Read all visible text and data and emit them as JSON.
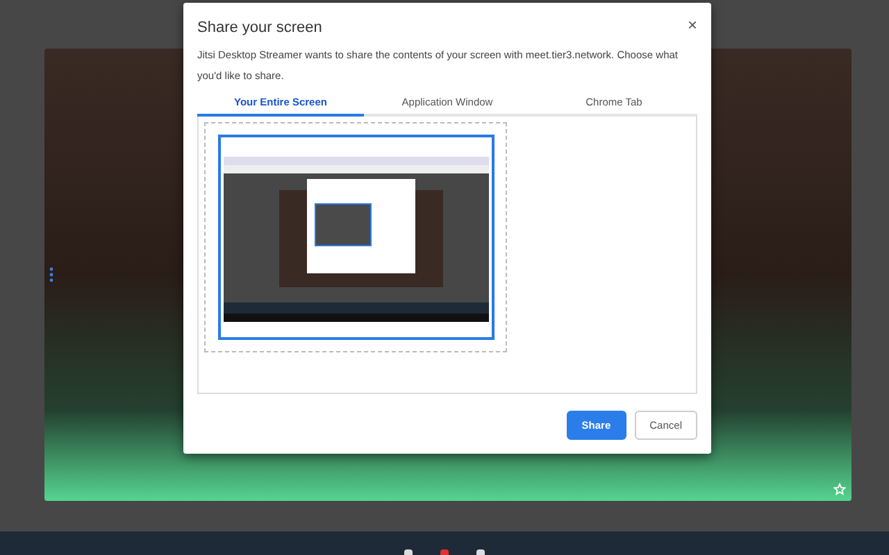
{
  "dialog": {
    "title": "Share your screen",
    "close": "×",
    "message": "Jitsi Desktop Streamer wants to share the contents of your screen with meet.tier3.network. Choose what you'd like to share.",
    "tabs": [
      {
        "label": "Your Entire Screen",
        "selected": true
      },
      {
        "label": "Application Window",
        "selected": false
      },
      {
        "label": "Chrome Tab",
        "selected": false
      }
    ],
    "sources": [
      {
        "selected": true
      }
    ],
    "buttons": [
      {
        "label": "Share",
        "kind": "primary"
      },
      {
        "label": "Cancel",
        "kind": "secondary"
      }
    ]
  }
}
